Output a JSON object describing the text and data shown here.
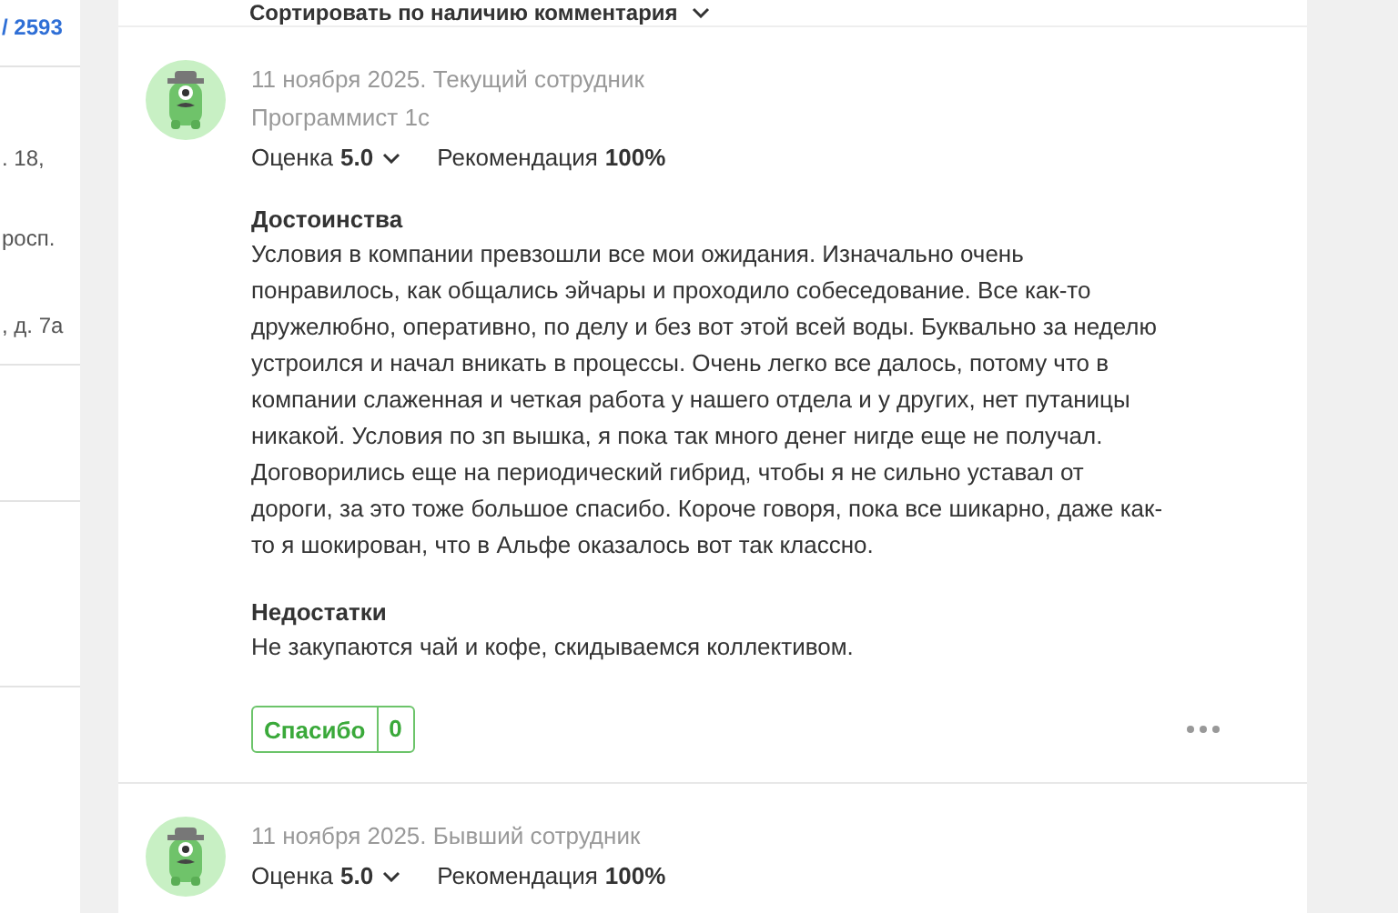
{
  "sidebar": {
    "fragments": [
      "/ 2593",
      ". 18,",
      "росп.",
      ", д. 7а"
    ]
  },
  "sort": {
    "label": "Сортировать по наличию комментария"
  },
  "reviews": [
    {
      "meta": "11 ноября 2025. Текущий сотрудник",
      "position": "Программист 1с",
      "rating_label": "Оценка",
      "rating": "5.0",
      "recommend_label": "Рекомендация",
      "recommend": "100%",
      "sections": [
        {
          "title": "Достоинства",
          "text": "Условия в компании превзошли все мои ожидания. Изначально очень понравилось, как общались эйчары и проходило собеседование. Все как-то дружелюбно, оперативно, по делу и без вот этой всей воды. Буквально за неделю устроился и начал вникать в процессы. Очень легко все далось, потому что в компании слаженная и четкая работа у нашего отдела и у других, нет путаницы никакой. Условия по зп вышка, я пока так много денег нигде еще не получал. Договорились еще на периодический гибрид, чтобы я не сильно уставал от дороги, за это тоже большое спасибо. Короче говоря, пока все шикарно, даже как-то я шокирован, что в Альфе оказалось вот так классно."
        },
        {
          "title": "Недостатки",
          "text": "Не закупаются чай и кофе, скидываемся коллективом."
        }
      ],
      "thanks": {
        "label": "Спасибо",
        "count": "0"
      }
    },
    {
      "meta": "11 ноября 2025. Бывший сотрудник",
      "rating_label": "Оценка",
      "rating": "5.0",
      "recommend_label": "Рекомендация",
      "recommend": "100%"
    }
  ]
}
